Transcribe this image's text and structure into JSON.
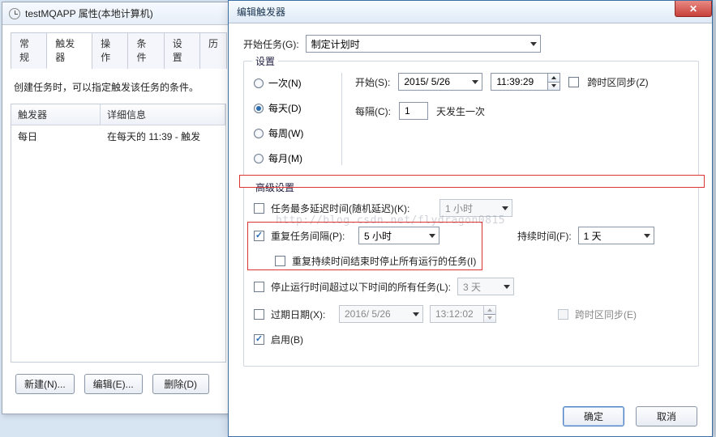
{
  "back_window": {
    "title": "testMQAPP 属性(本地计算机)",
    "tabs": [
      "常规",
      "触发器",
      "操作",
      "条件",
      "设置",
      "历"
    ],
    "active_tab_index": 1,
    "hint": "创建任务时，可以指定触发该任务的条件。",
    "columns": {
      "c1": "触发器",
      "c2": "详细信息"
    },
    "rows": [
      {
        "c1": "每日",
        "c2": "在每天的 11:39 - 触发"
      }
    ],
    "buttons": {
      "new": "新建(N)...",
      "edit": "编辑(E)...",
      "delete": "删除(D)"
    }
  },
  "front_window": {
    "title": "编辑触发器",
    "begin_task_label": "开始任务(G):",
    "begin_task_value": "制定计划时",
    "settings_title": "设置",
    "radios": {
      "once": "一次(N)",
      "daily": "每天(D)",
      "weekly": "每周(W)",
      "monthly": "每月(M)",
      "selected": "daily"
    },
    "start_label": "开始(S):",
    "start_date": "2015/ 5/26",
    "start_time": "11:39:29",
    "sync_tz_label": "跨时区同步(Z)",
    "every_label": "每隔(C):",
    "every_value": "1",
    "every_suffix": "天发生一次",
    "advanced_title": "高级设置",
    "adv": {
      "rand_delay_label": "任务最多延迟时间(随机延迟)(K):",
      "rand_delay_value": "1 小时",
      "repeat_label": "重复任务间隔(P):",
      "repeat_value": "5 小时",
      "duration_label": "持续时间(F):",
      "duration_value": "1 天",
      "stop_at_end_label": "重复持续时间结束时停止所有运行的任务(I)",
      "stop_longer_label": "停止运行时间超过以下时间的所有任务(L):",
      "stop_longer_value": "3 天",
      "expire_label": "过期日期(X):",
      "expire_date": "2016/ 5/26",
      "expire_time": "13:12:02",
      "expire_sync_label": "跨时区同步(E)",
      "enabled_label": "启用(B)"
    },
    "buttons": {
      "ok": "确定",
      "cancel": "取消"
    }
  },
  "watermark": "http://blog.csdn.net/flydragon0815"
}
